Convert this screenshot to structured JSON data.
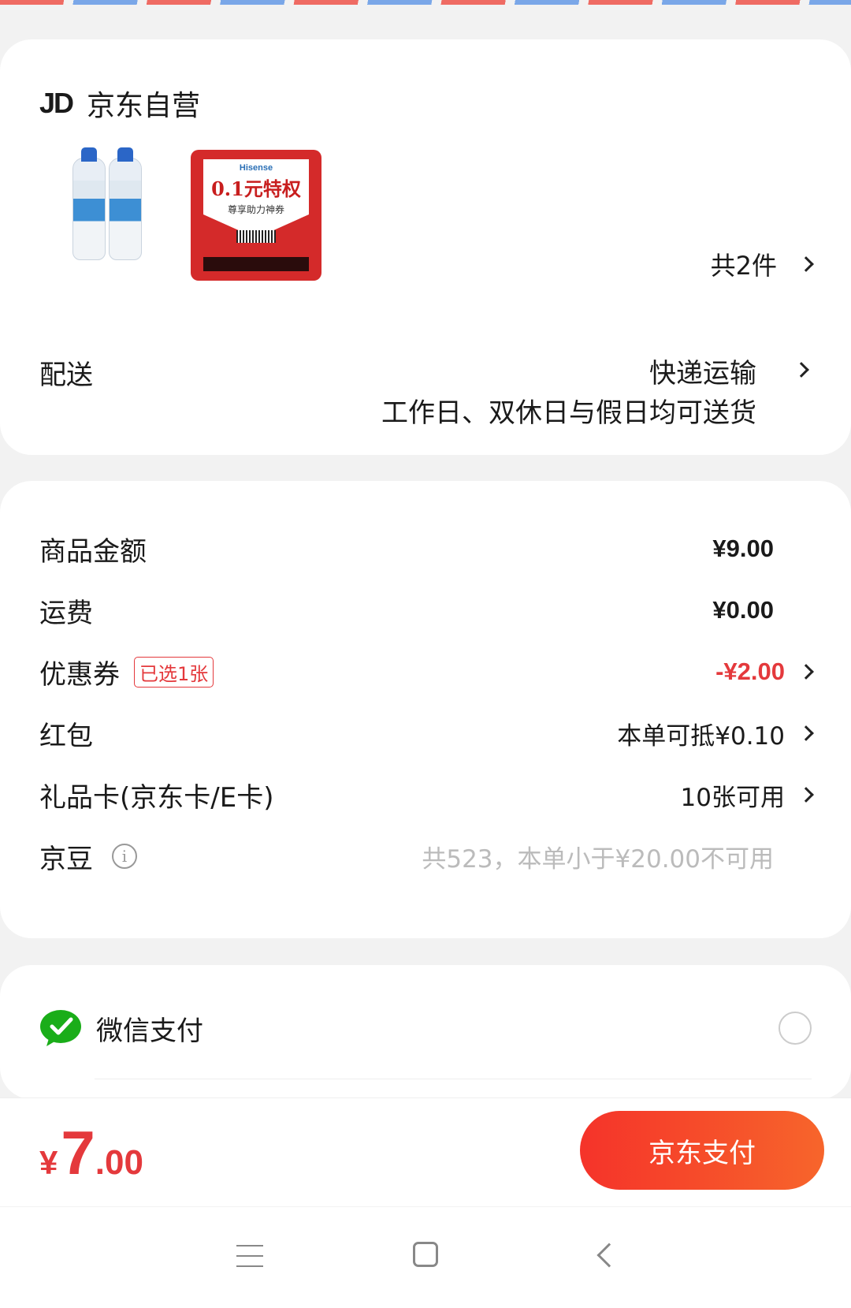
{
  "order": {
    "shop_name": "京东自营",
    "shop_logo": "JD",
    "items": [
      {
        "name": "bottle-product-thumbnail"
      },
      {
        "name": "coupon-product-thumbnail",
        "brand": "Hisense",
        "headline": "0.1元特权",
        "subline": "尊享助力神券"
      }
    ],
    "item_count": "共2件",
    "shipping": {
      "label": "配送",
      "method": "快递运输",
      "note": "工作日、双休日与假日均可送货"
    }
  },
  "pricing": {
    "rows": [
      {
        "label": "商品金额",
        "value": "¥9.00"
      },
      {
        "label": "运费",
        "value": "¥0.00"
      },
      {
        "label": "优惠券",
        "tag": "已选1张",
        "value": "-¥2.00",
        "value_color": "#e4393c"
      },
      {
        "label": "红包",
        "value": "本单可抵¥0.10"
      },
      {
        "label": "礼品卡(京东卡/E卡)",
        "value": "10张可用"
      },
      {
        "label": "京豆",
        "value": "共523，本单小于¥20.00不可用"
      }
    ]
  },
  "payment": {
    "method_label": "微信支付",
    "icon": "wechat-icon",
    "selected": false
  },
  "footer": {
    "total_currency": "¥",
    "total_integer": "7",
    "total_decimal": ".00",
    "pay_button": "京东支付"
  },
  "colors": {
    "accent": "#e4393c",
    "button_start": "#f5332a",
    "button_end": "#f7652b",
    "wechat": "#1aad19"
  },
  "system_nav": {
    "icons": [
      "menu-icon",
      "home-icon",
      "back-icon"
    ]
  }
}
